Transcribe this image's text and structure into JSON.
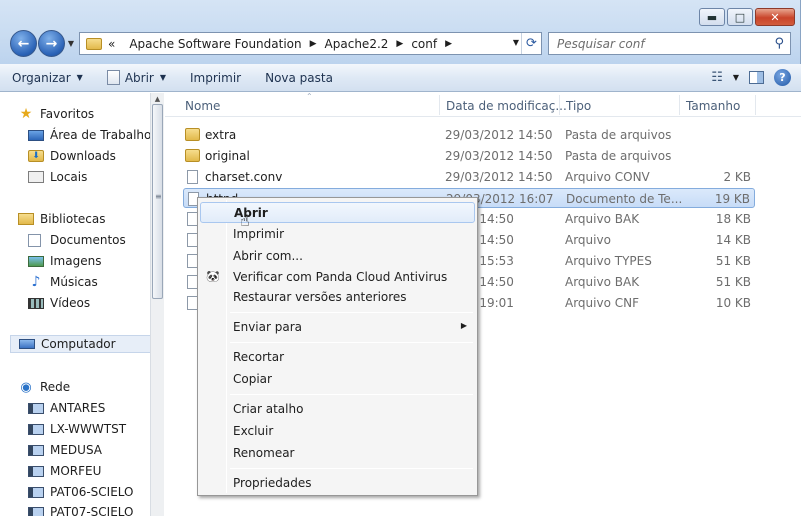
{
  "window": {
    "controls": {
      "minimize": "▬",
      "maximize": "□",
      "close": "✕"
    }
  },
  "address": {
    "overflow": "«",
    "crumbs": [
      "Apache Software Foundation",
      "Apache2.2",
      "conf"
    ]
  },
  "search": {
    "placeholder": "Pesquisar conf"
  },
  "commandbar": {
    "organize": "Organizar",
    "open": "Abrir",
    "print": "Imprimir",
    "new_folder": "Nova pasta"
  },
  "navpane": {
    "favorites": "Favoritos",
    "desktop": "Área de Trabalho",
    "downloads": "Downloads",
    "places": "Locais",
    "libraries": "Bibliotecas",
    "documents": "Documentos",
    "images": "Imagens",
    "music": "Músicas",
    "videos": "Vídeos",
    "computer": "Computador",
    "network": "Rede",
    "hosts": [
      "ANTARES",
      "LX-WWWTST",
      "MEDUSA",
      "MORFEU",
      "PAT06-SCIELO",
      "PAT07-SCIELO"
    ]
  },
  "columns": {
    "name": "Nome",
    "date": "Data de modificaç...",
    "type": "Tipo",
    "size": "Tamanho"
  },
  "files": [
    {
      "name": "extra",
      "date": "29/03/2012 14:50",
      "type": "Pasta de arquivos",
      "size": ""
    },
    {
      "name": "original",
      "date": "29/03/2012 14:50",
      "type": "Pasta de arquivos",
      "size": ""
    },
    {
      "name": "charset.conv",
      "date": "29/03/2012 14:50",
      "type": "Arquivo CONV",
      "size": "2 KB"
    },
    {
      "name": "httpd",
      "date": "29/03/2012 16:07",
      "type": "Documento de Te...",
      "size": "19 KB"
    },
    {
      "name": "",
      "date": "2012 14:50",
      "type": "Arquivo BAK",
      "size": "18 KB"
    },
    {
      "name": "",
      "date": "2012 14:50",
      "type": "Arquivo",
      "size": "14 KB"
    },
    {
      "name": "",
      "date": "2012 15:53",
      "type": "Arquivo TYPES",
      "size": "51 KB"
    },
    {
      "name": "",
      "date": "2012 14:50",
      "type": "Arquivo BAK",
      "size": "51 KB"
    },
    {
      "name": "",
      "date": "2011 19:01",
      "type": "Arquivo CNF",
      "size": "10 KB"
    }
  ],
  "context_menu": {
    "open": "Abrir",
    "print": "Imprimir",
    "open_with": "Abrir com...",
    "panda": "Verificar com Panda Cloud Antivirus",
    "restore": "Restaurar versões anteriores",
    "send_to": "Enviar para",
    "cut": "Recortar",
    "copy": "Copiar",
    "shortcut": "Criar atalho",
    "delete": "Excluir",
    "rename": "Renomear",
    "properties": "Propriedades"
  }
}
